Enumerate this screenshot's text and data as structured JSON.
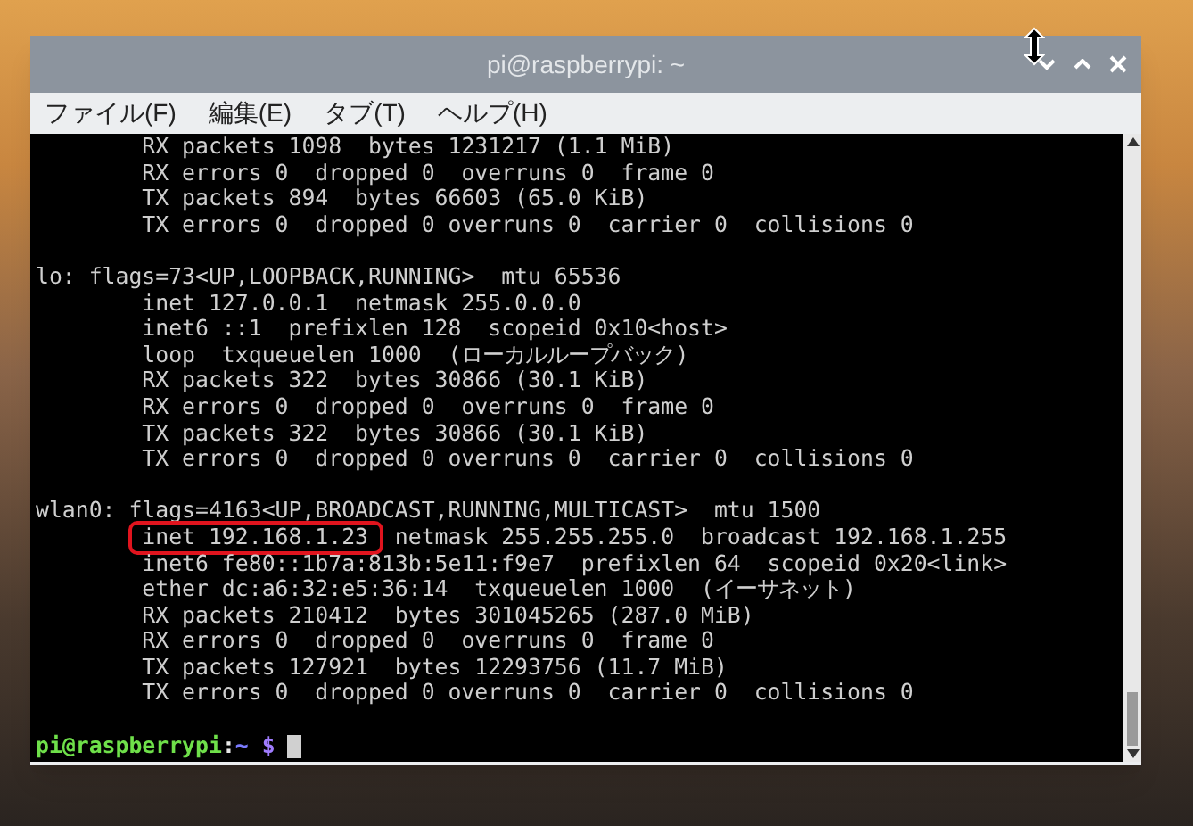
{
  "window": {
    "title": "pi@raspberrypi: ~"
  },
  "menu": [
    {
      "label": "ファイル(F)"
    },
    {
      "label": "編集(E)"
    },
    {
      "label": "タブ(T)"
    },
    {
      "label": "ヘルプ(H)"
    }
  ],
  "terminal": {
    "lines": [
      {
        "kind": "text",
        "text": "        RX packets 1098  bytes 1231217 (1.1 MiB)"
      },
      {
        "kind": "text",
        "text": "        RX errors 0  dropped 0  overruns 0  frame 0"
      },
      {
        "kind": "text",
        "text": "        TX packets 894  bytes 66603 (65.0 KiB)"
      },
      {
        "kind": "text",
        "text": "        TX errors 0  dropped 0 overruns 0  carrier 0  collisions 0"
      },
      {
        "kind": "blank"
      },
      {
        "kind": "text",
        "text": "lo: flags=73<UP,LOOPBACK,RUNNING>  mtu 65536"
      },
      {
        "kind": "text",
        "text": "        inet 127.0.0.1  netmask 255.0.0.0"
      },
      {
        "kind": "text",
        "text": "        inet6 ::1  prefixlen 128  scopeid 0x10<host>"
      },
      {
        "kind": "text",
        "text": "        loop  txqueuelen 1000  (ローカルループバック)"
      },
      {
        "kind": "text",
        "text": "        RX packets 322  bytes 30866 (30.1 KiB)"
      },
      {
        "kind": "text",
        "text": "        RX errors 0  dropped 0  overruns 0  frame 0"
      },
      {
        "kind": "text",
        "text": "        TX packets 322  bytes 30866 (30.1 KiB)"
      },
      {
        "kind": "text",
        "text": "        TX errors 0  dropped 0 overruns 0  carrier 0  collisions 0"
      },
      {
        "kind": "blank"
      },
      {
        "kind": "text",
        "text": "wlan0: flags=4163<UP,BROADCAST,RUNNING,MULTICAST>  mtu 1500"
      },
      {
        "kind": "marked",
        "marked": "inet 192.168.1.23",
        "rest": "  netmask 255.255.255.0  broadcast 192.168.1.255"
      },
      {
        "kind": "text",
        "text": "        inet6 fe80::1b7a:813b:5e11:f9e7  prefixlen 64  scopeid 0x20<link>"
      },
      {
        "kind": "text",
        "text": "        ether dc:a6:32:e5:36:14  txqueuelen 1000  (イーサネット)"
      },
      {
        "kind": "text",
        "text": "        RX packets 210412  bytes 301045265 (287.0 MiB)"
      },
      {
        "kind": "text",
        "text": "        RX errors 0  dropped 0  overruns 0  frame 0"
      },
      {
        "kind": "text",
        "text": "        TX packets 127921  bytes 12293756 (11.7 MiB)"
      },
      {
        "kind": "text",
        "text": "        TX errors 0  dropped 0 overruns 0  carrier 0  collisions 0"
      },
      {
        "kind": "blank"
      }
    ],
    "prompt": {
      "user_host": "pi@raspberrypi",
      "separator": ":",
      "path": "~",
      "symbol": "$"
    }
  }
}
